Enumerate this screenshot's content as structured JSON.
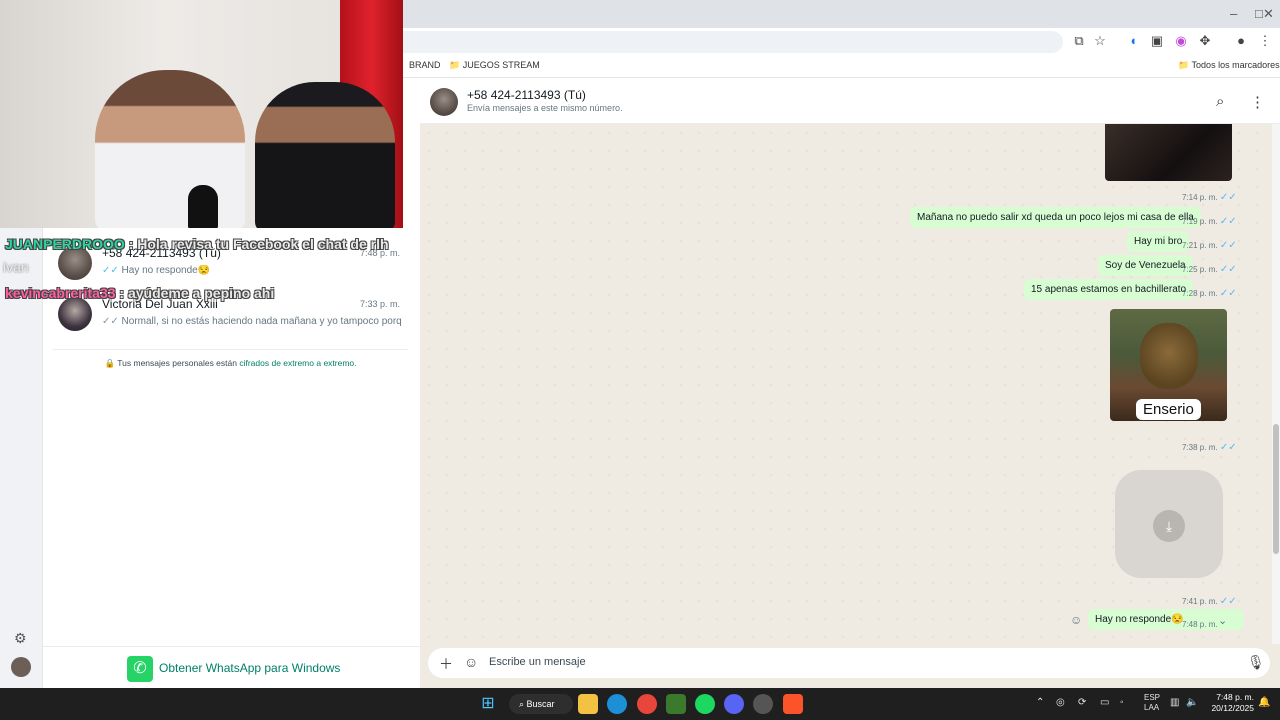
{
  "stream_chat": {
    "line1_user": "JUANPERDROOO",
    "line1_msg": ": Hola revisa tu Facebook el chat de rlh",
    "line2": "ivan",
    "line3_user": "kevincabrerita33",
    "line3_msg": ": ayúdeme a pepino ahi"
  },
  "window_controls": {
    "minimize": "–",
    "maximize": "□",
    "close": "✕"
  },
  "bookmarks": {
    "brand": "BRAND",
    "juegos": "JUEGOS STREAM",
    "all": "Todos los marcadores"
  },
  "chat_list": [
    {
      "name": "+58 424-2113493 (Tú)",
      "time": "7:48 p. m.",
      "preview": "Hay no responde😒"
    },
    {
      "name": "Victoria Del Juan Xxiii",
      "time": "7:33 p. m.",
      "preview": "Normall, si no estás haciendo nada mañana y yo tampoco porque n..."
    }
  ],
  "encryption": {
    "text": "Tus mensajes personales están ",
    "link": "cifrados de extremo a extremo."
  },
  "get_whatsapp": "Obtener WhatsApp para Windows",
  "conversation": {
    "title": "+58 424-2113493 (Tú)",
    "subtitle": "Envía mensajes a este mismo número.",
    "messages": [
      {
        "text": "",
        "time": "7:14 p. m."
      },
      {
        "text": "Mañana no puedo salir xd queda un poco lejos mi casa de ella",
        "time": "7:19 p. m."
      },
      {
        "text": "Hay mi bro",
        "time": "7:21 p. m."
      },
      {
        "text": "Soy de Venezuela",
        "time": "7:25 p. m."
      },
      {
        "text": "15 apenas estamos en bachillerato",
        "time": "7:28 p. m."
      },
      {
        "text": "Enserio",
        "time": "7:38 p. m."
      },
      {
        "text": "",
        "time": "7:41 p. m."
      },
      {
        "text": "Hay no responde😒",
        "time": "7:48 p. m."
      }
    ]
  },
  "composer": {
    "placeholder": "Escribe un mensaje"
  },
  "taskbar": {
    "search": "Buscar",
    "lang": "ESP",
    "lang2": "LAA",
    "time": "7:48 p. m.",
    "date": "20/12/2025"
  },
  "colors": {
    "bubble": "#d9fdd3",
    "wallpaper": "#efeae2",
    "accent": "#008069",
    "tick": "#53bdeb"
  }
}
